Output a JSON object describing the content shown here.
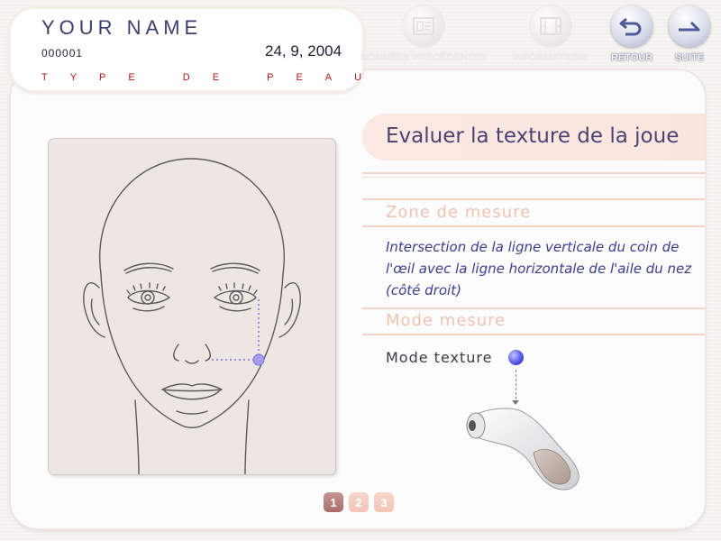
{
  "header": {
    "patient_name": "YOUR NAME",
    "patient_id": "000001",
    "date": "24, 9, 2004",
    "skin_type": "TYPE DE PEAU"
  },
  "toolbar": {
    "buttons": [
      {
        "label": "DONNÉES PRÉCÉDENTES",
        "icon": "chart-document-icon",
        "enabled": false
      },
      {
        "label": "INFORMATIONS",
        "icon": "film-icon",
        "enabled": false
      },
      {
        "label": "RETOUR",
        "icon": "return-arrow-icon",
        "enabled": true
      },
      {
        "label": "SUITE",
        "icon": "next-arrow-icon",
        "enabled": true
      }
    ]
  },
  "main": {
    "title": "Evaluer la texture de la joue",
    "zone_heading": "Zone de mesure",
    "zone_description": "Intersection de la ligne verticale du coin de l'œil avec la ligne horizontale de l'aile du nez (côté droit)",
    "mode_heading": "Mode mesure",
    "mode_value": "Mode texture"
  },
  "pager": {
    "pages": [
      "1",
      "2",
      "3"
    ],
    "current": 1
  },
  "colors": {
    "title_text": "#4b4270",
    "description_text": "#3b3d8f",
    "section_heading": "#f0c2b2",
    "skin_type_text": "#b01818",
    "measure_point": "#8f86e6",
    "mode_indicator": "#5657e8"
  },
  "icons": {
    "face_illustration": "face-diagram-icon",
    "measure_point": "measure-point-icon",
    "probe_device": "skin-probe-device-icon"
  }
}
